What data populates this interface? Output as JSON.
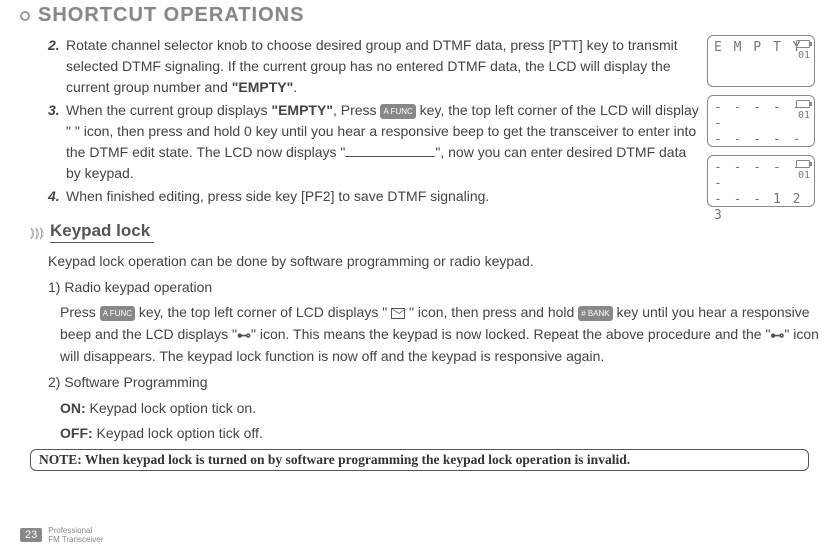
{
  "header": {
    "title": "SHORTCUT OPERATIONS"
  },
  "steps": {
    "s2": {
      "num": "2.",
      "t1": "Rotate channel selector knob to choose desired group and DTMF data, press [PTT] key to transmit selected DTMF signaling. If the current group has no entered DTMF data, the LCD will display the current group number and ",
      "t1b": "\"EMPTY\"",
      "t1c": "."
    },
    "s3": {
      "num": "3.",
      "t1": "When the current group displays ",
      "t1b": "\"EMPTY\"",
      "t1c": ", Press ",
      "key1": "A FUNC",
      "t2": " key, the top left corner of the LCD will display \" \" icon, then press and hold 0 key until you hear a responsive beep to get the transceiver to enter into the DTMF edit state. The LCD now displays \"",
      "t3": "\", now you can enter desired DTMF data by keypad."
    },
    "s4": {
      "num": "4.",
      "t1": "When finished editing, press side key [PF2] to save DTMF signaling."
    }
  },
  "lcd": {
    "a": {
      "l1": "E M P T Y",
      "n": "01"
    },
    "b": {
      "l1": "- - - - - -",
      "l2": "- - - - - -",
      "n": "01"
    },
    "c": {
      "l1": "- - - - - -",
      "l2": "- - - 1 2 3",
      "n": "01"
    }
  },
  "section2": {
    "heading": "Keypad lock",
    "intro": "Keypad lock operation can be done by software programming or radio keypad.",
    "p1head": "1) Radio keypad operation",
    "p1a": "Press ",
    "keyA": "A FUNC",
    "p1b": " key, the top left corner of LCD displays \" ",
    "p1c": " \" icon, then press and hold ",
    "keyB": "# BANK",
    "p1d": " key until you hear a responsive beep and the LCD displays \"",
    "lock1": "⊷",
    "p1e": "\" icon. This means the keypad is now locked. Repeat the above procedure and the \"",
    "lock2": "⊷",
    "p1f": "\" icon will disappears. The keypad lock function is now off and the keypad is responsive again.",
    "p2head": "2) Software Programming",
    "on": "ON:",
    "onText": " Keypad lock option tick on.",
    "off": "OFF:",
    "offText": " Keypad lock option tick off."
  },
  "note": "NOTE: When keypad lock is turned on by software programming the keypad lock operation is invalid.",
  "footer": {
    "page": "23",
    "line1": "Professional",
    "line2": "FM Transceiver"
  }
}
